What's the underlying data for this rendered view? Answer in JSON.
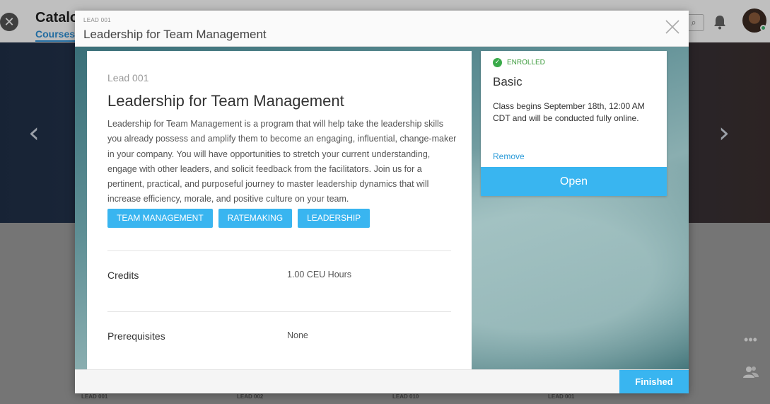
{
  "background": {
    "title": "Catalo",
    "subtab": "Courses",
    "card_codes": [
      "LEAD 001",
      "LEAD 002",
      "LEAD 010",
      "LEAD 001"
    ]
  },
  "modal": {
    "header_code": "LEAD 001",
    "header_title": "Leadership for Team Management",
    "course": {
      "code": "Lead 001",
      "title": "Leadership for Team Management",
      "description": "Leadership for Team Management is a program that will help take the leadership skills you already possess and amplify them to become an engaging, influential, change-maker in your company. You will have opportunities to stretch your current understanding, engage with other leaders, and solicit feedback from the facilitators. Join us for a pertinent, practical, and purposeful journey to master leadership dynamics that will increase efficiency, morale, and positive culture on your team.",
      "tags": [
        "TEAM MANAGEMENT",
        "RATEMAKING",
        "LEADERSHIP"
      ],
      "details": [
        {
          "label": "Credits",
          "value": "1.00 CEU Hours"
        },
        {
          "label": "Prerequisites",
          "value": "None"
        }
      ]
    },
    "enrollment": {
      "status": "ENROLLED",
      "plan": "Basic",
      "schedule": "Class begins September 18th, 12:00 AM CDT and will be conducted fully online.",
      "remove_label": "Remove",
      "open_label": "Open"
    },
    "footer": {
      "finished_label": "Finished"
    }
  },
  "colors": {
    "accent": "#39b5f0",
    "enrolled": "#3aaa4a",
    "link": "#2a9ad8"
  }
}
